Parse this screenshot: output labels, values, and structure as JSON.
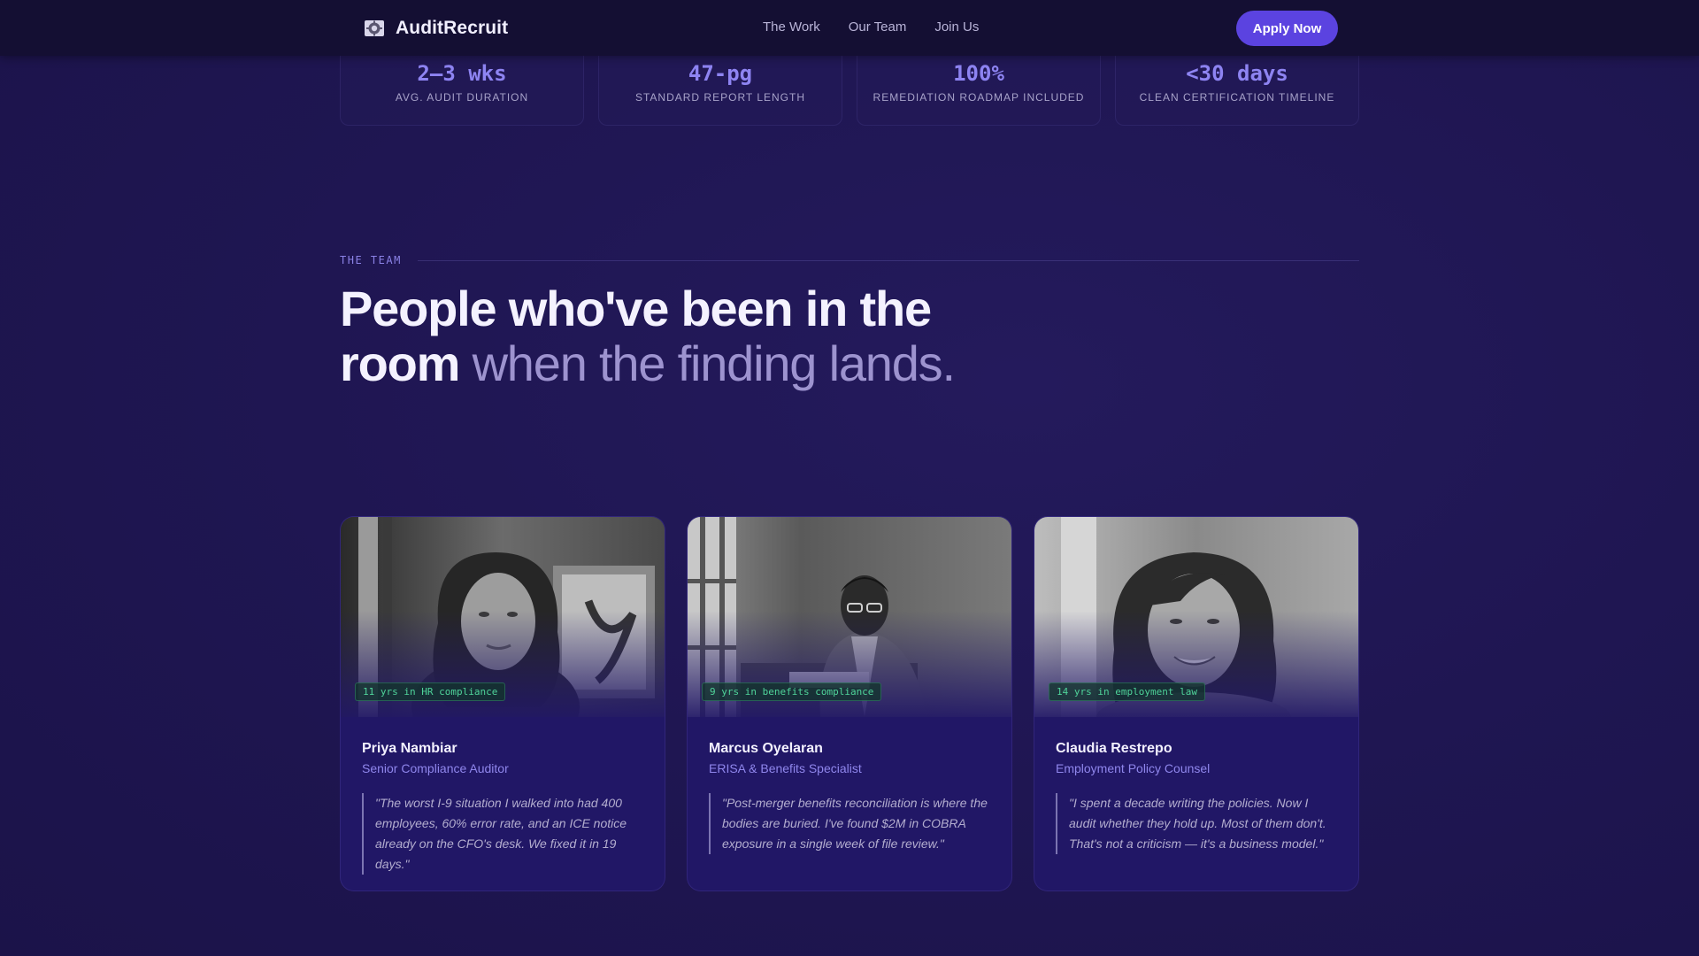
{
  "nav": {
    "brand": "AuditRecruit",
    "brand_icon": "gear-icon",
    "links": [
      "The Work",
      "Our Team",
      "Join Us"
    ],
    "cta": "Apply Now"
  },
  "stats": [
    {
      "value": "2–3 wks",
      "label": "AVG. AUDIT DURATION"
    },
    {
      "value": "47-pg",
      "label": "STANDARD REPORT LENGTH"
    },
    {
      "value": "100%",
      "label": "REMEDIATION ROADMAP INCLUDED"
    },
    {
      "value": "<30 days",
      "label": "CLEAN CERTIFICATION TIMELINE"
    }
  ],
  "team": {
    "eyebrow": "THE TEAM",
    "headline_strong": "People who've been in the room",
    "headline_muted": "when the finding lands.",
    "members": [
      {
        "badge": "11 yrs in HR compliance",
        "name": "Priya Nambiar",
        "role": "Senior Compliance Auditor",
        "quote": "\"The worst I-9 situation I walked into had 400 employees, 60% error rate, and an ICE notice already on the CFO's desk. We fixed it in 19 days.\""
      },
      {
        "badge": "9 yrs in benefits compliance",
        "name": "Marcus Oyelaran",
        "role": "ERISA & Benefits Specialist",
        "quote": "\"Post-merger benefits reconciliation is where the bodies are buried. I've found $2M in COBRA exposure in a single week of file review.\""
      },
      {
        "badge": "14 yrs in employment law",
        "name": "Claudia Restrepo",
        "role": "Employment Policy Counsel",
        "quote": "\"I spent a decade writing the policies. Now I audit whether they hold up. Most of them don't. That's not a criticism — it's a business model.\""
      }
    ]
  },
  "colors": {
    "background": "#1f1652",
    "nav": "#140f33",
    "accent": "#5b43e0",
    "stat_value": "#8e84f2",
    "badge_text": "#4fd39a"
  }
}
